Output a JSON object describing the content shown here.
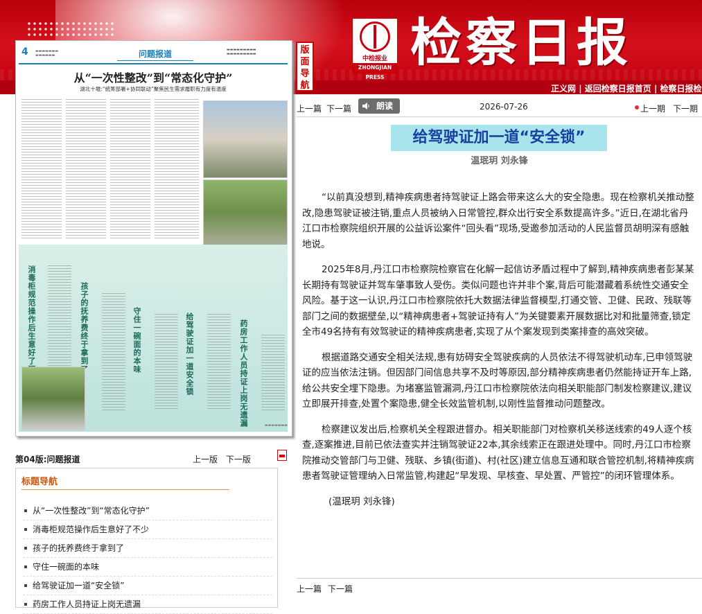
{
  "header": {
    "masthead": "检察日报",
    "logo_cn": "中检报业",
    "logo_en": "ZHONGJIAN PRESS",
    "links": [
      "正义网",
      "返回检察日报首页",
      "检察日报检"
    ],
    "sidebar_tag": "版面导航"
  },
  "thumbnail": {
    "page_number": "4",
    "section": "问题报道",
    "headline": "从“一次性整改”到“常态化守护”",
    "subhead": "湖北十堰:“统筹部署+协同联动”聚焦民生需求履职有力度有温度",
    "column_titles": [
      "消毒柜规范操作后生意好了不少",
      "孩子的抚养费终于拿到了",
      "守住一碗面的本味",
      "给驾驶证加一道安全锁",
      "药房工作人员持证上岗无遗漏"
    ]
  },
  "page_info": {
    "label": "第04版:问题报道",
    "prev": "上一版",
    "next": "下一版"
  },
  "title_nav": {
    "heading": "标题导航",
    "items": [
      "从“一次性整改”到“常态化守护”",
      "消毒柜规范操作后生意好了不少",
      "孩子的抚养费终于拿到了",
      "守住一碗面的本味",
      "给驾驶证加一道“安全锁”",
      "药房工作人员持证上岗无遗漏"
    ]
  },
  "topbar": {
    "prev": "上一篇",
    "next": "下一篇",
    "read": "朗读",
    "date": "2026-07-26",
    "prev_issue": "上一期",
    "next_issue": "下一期"
  },
  "article": {
    "title": "给驾驶证加一道“安全锁”",
    "author": "温珉玥 刘永锋",
    "paragraphs": [
      "“以前真没想到,精神疾病患者持驾驶证上路会带来这么大的安全隐患。现在检察机关推动整改,隐患驾驶证被注销,重点人员被纳入日常管控,群众出行安全系数提高许多。”近日,在湖北省丹江口市检察院组织开展的公益诉讼案件“回头看”现场,受邀参加活动的人民监督员胡明深有感触地说。",
      "2025年8月,丹江口市检察院检察官在化解一起信访矛盾过程中了解到,精神疾病患者彭某某长期持有驾驶证并驾车肇事致人受伤。类似问题也许并非个案,背后可能潜藏着系统性交通安全风险。基于这一认识,丹江口市检察院依托大数据法律监督模型,打通交管、卫健、民政、残联等部门之间的数据壁垒,以“精神病患者+驾驶证持有人”为关键要素开展数据比对和批量筛查,锁定全市49名持有有效驾驶证的精神疾病患者,实现了从个案发现到类案排查的高效突破。",
      "根据道路交通安全相关法规,患有妨碍安全驾驶疾病的人员依法不得驾驶机动车,已申领驾驶证的应当依法注销。但因部门间信息共享不及时等原因,部分精神疾病患者仍然能持证开车上路,给公共安全埋下隐患。为堵塞监管漏洞,丹江口市检察院依法向相关职能部门制发检察建议,建议立即展开排查,处置个案隐患,健全长效监管机制,以刚性监督推动问题整改。",
      "检察建议发出后,检察机关全程跟进督办。相关职能部门对检察机关移送线索的49人逐个核查,逐案推进,目前已依法查实并注销驾驶证22本,其余线索正在跟进处理中。同时,丹江口市检察院推动交管部门与卫健、残联、乡镇(街道)、村(社区)建立信息互通和联合管控机制,将精神疾病患者驾驶证管理纳入日常监管,构建起“早发现、早核查、早处置、严管控”的闭环管理体系。"
    ],
    "byline": "(温珉玥 刘永锋)"
  },
  "bottombar": {
    "prev": "上一篇",
    "next": "下一篇"
  },
  "colors": {
    "header_red": "#c8000f",
    "title_highlight": "#a8e4ec",
    "title_text": "#1a3fa0",
    "nav_heading": "#d2560a",
    "thumb_accent": "#1e7fb8"
  }
}
